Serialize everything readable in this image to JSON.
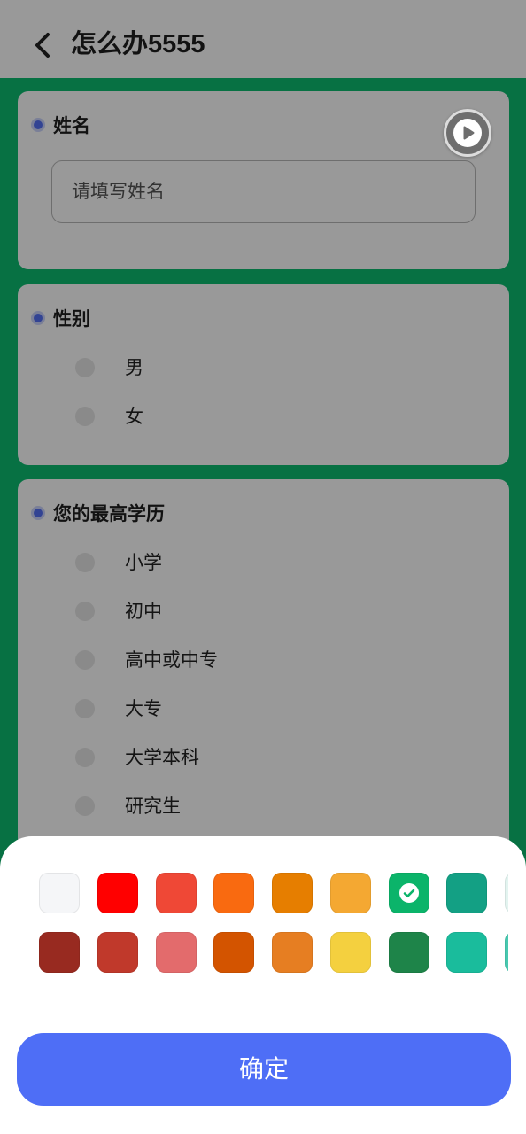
{
  "header": {
    "back_icon": "chevron-left-icon",
    "title": "怎么办5555"
  },
  "theme": {
    "page_background": "#0cbc70",
    "card_background": "#ffffff",
    "mask_color": "rgba(0,0,0,0.4)",
    "required_dot": "#5470f5",
    "radio_fill": "#e6e6e6",
    "confirm_background": "#4e6ef6",
    "confirm_text": "#ffffff"
  },
  "questions": [
    {
      "label": "姓名",
      "placeholder": "请填写姓名"
    },
    {
      "label": "性别",
      "options": [
        "男",
        "女"
      ]
    },
    {
      "label": "您的最高学历",
      "options": [
        "小学",
        "初中",
        "高中或中专",
        "大专",
        "大学本科",
        "研究生"
      ]
    }
  ],
  "play_button": {
    "icon": "play-icon"
  },
  "color_picker": {
    "selected_icon": "check-icon",
    "rows": [
      [
        {
          "color": "#f5f6f8"
        },
        {
          "color": "#ff0000"
        },
        {
          "color": "#ef4836"
        },
        {
          "color": "#f96a10"
        },
        {
          "color": "#e67e00"
        },
        {
          "color": "#f4a832"
        },
        {
          "color": "#0bb46a",
          "selected": true
        },
        {
          "color": "#13a084"
        },
        {
          "color": "#e3f4f0"
        }
      ],
      [
        {
          "color": "#982a20"
        },
        {
          "color": "#c0392b"
        },
        {
          "color": "#e36b6c"
        },
        {
          "color": "#d35400"
        },
        {
          "color": "#e67e22"
        },
        {
          "color": "#f4d03f"
        },
        {
          "color": "#1e8449"
        },
        {
          "color": "#1abc9c"
        },
        {
          "color": "#48c9b0"
        }
      ]
    ]
  },
  "confirm_label": "确定"
}
